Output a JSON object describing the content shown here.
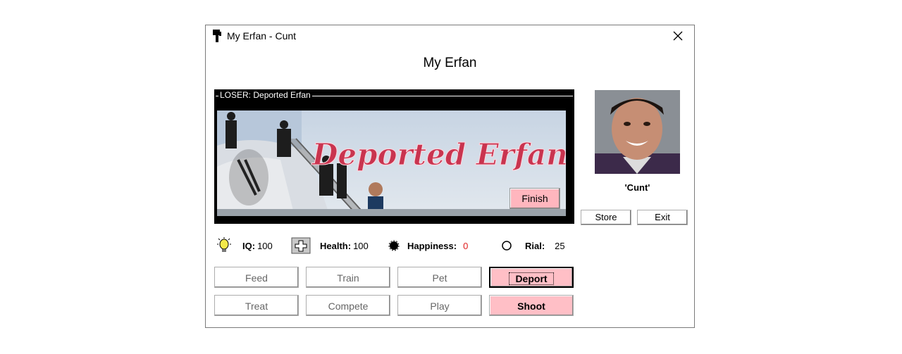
{
  "window": {
    "title": "My Erfan - Cunt"
  },
  "header": {
    "title": "My Erfan"
  },
  "group": {
    "label": "LOSER: Deported Erfan",
    "banner_text": "Deported Erfan"
  },
  "finish_label": "Finish",
  "pet": {
    "name": "'Cunt'"
  },
  "side_buttons": {
    "store": "Store",
    "exit": "Exit"
  },
  "stats": {
    "iq": {
      "label": "IQ:",
      "value": "100"
    },
    "health": {
      "label": "Health:",
      "value": "100"
    },
    "happiness": {
      "label": "Happiness:",
      "value": "0",
      "value_color": "#e02020"
    },
    "rial": {
      "label": "Rial:",
      "value": "25"
    }
  },
  "actions": {
    "feed": "Feed",
    "train": "Train",
    "pet": "Pet",
    "deport": "Deport",
    "treat": "Treat",
    "compete": "Compete",
    "play": "Play",
    "shoot": "Shoot"
  },
  "colors": {
    "accent_pink": "#ffbfc6",
    "banner_text": "#c9344f"
  }
}
